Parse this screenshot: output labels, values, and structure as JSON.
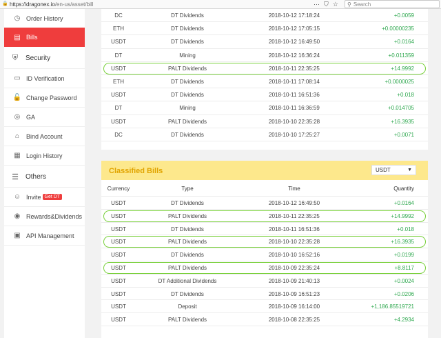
{
  "browser": {
    "url_host": "https://dragonex.io",
    "url_path": "/en-us/asset/bill",
    "search_placeholder": "Search"
  },
  "sidebar": {
    "items": [
      {
        "label": "Order History",
        "icon": "history-icon"
      },
      {
        "label": "Bills",
        "icon": "bill-icon",
        "active": true
      }
    ],
    "security_title": "Security",
    "security_items": [
      {
        "label": "ID Verification",
        "icon": "id-card-icon"
      },
      {
        "label": "Change Password",
        "icon": "lock-icon"
      },
      {
        "label": "GA",
        "icon": "google-auth-icon"
      },
      {
        "label": "Bind Account",
        "icon": "link-icon"
      },
      {
        "label": "Login History",
        "icon": "calendar-icon"
      }
    ],
    "others_title": "Others",
    "others_items": [
      {
        "label": "Invite",
        "badge": "Get DT",
        "icon": "user-icon"
      },
      {
        "label": "Rewards&Dividends",
        "icon": "reward-icon"
      },
      {
        "label": "API Management",
        "icon": "api-icon"
      }
    ]
  },
  "bills": {
    "rows": [
      {
        "currency": "DC",
        "type": "DT Dividends",
        "time": "2018-10-12 17:18:24",
        "quantity": "+0.0059"
      },
      {
        "currency": "ETH",
        "type": "DT Dividends",
        "time": "2018-10-12 17:05:15",
        "quantity": "+0.00000235"
      },
      {
        "currency": "USDT",
        "type": "DT Dividends",
        "time": "2018-10-12 16:49:50",
        "quantity": "+0.0164"
      },
      {
        "currency": "DT",
        "type": "Mining",
        "time": "2018-10-12 16:36:24",
        "quantity": "+0.011359"
      },
      {
        "currency": "USDT",
        "type": "PALT Dividends",
        "time": "2018-10-11 22:35:25",
        "quantity": "+14.9992"
      },
      {
        "currency": "ETH",
        "type": "DT Dividends",
        "time": "2018-10-11 17:08:14",
        "quantity": "+0.0000025"
      },
      {
        "currency": "USDT",
        "type": "DT Dividends",
        "time": "2018-10-11 16:51:36",
        "quantity": "+0.018"
      },
      {
        "currency": "DT",
        "type": "Mining",
        "time": "2018-10-11 16:36:59",
        "quantity": "+0.014705"
      },
      {
        "currency": "USDT",
        "type": "PALT Dividends",
        "time": "2018-10-10 22:35:28",
        "quantity": "+16.3935"
      },
      {
        "currency": "DC",
        "type": "DT Dividends",
        "time": "2018-10-10 17:25:27",
        "quantity": "+0.0071"
      }
    ]
  },
  "classified": {
    "title": "Classified Bills",
    "selected_currency": "USDT",
    "headers": {
      "currency": "Currency",
      "type": "Type",
      "time": "Time",
      "quantity": "Quantity"
    },
    "rows": [
      {
        "currency": "USDT",
        "type": "DT Dividends",
        "time": "2018-10-12 16:49:50",
        "quantity": "+0.0164"
      },
      {
        "currency": "USDT",
        "type": "PALT Dividends",
        "time": "2018-10-11 22:35:25",
        "quantity": "+14.9992"
      },
      {
        "currency": "USDT",
        "type": "DT Dividends",
        "time": "2018-10-11 16:51:36",
        "quantity": "+0.018"
      },
      {
        "currency": "USDT",
        "type": "PALT Dividends",
        "time": "2018-10-10 22:35:28",
        "quantity": "+16.3935"
      },
      {
        "currency": "USDT",
        "type": "DT Dividends",
        "time": "2018-10-10 16:52:16",
        "quantity": "+0.0199"
      },
      {
        "currency": "USDT",
        "type": "PALT Dividends",
        "time": "2018-10-09 22:35:24",
        "quantity": "+8.8117"
      },
      {
        "currency": "USDT",
        "type": "DT Additional Dividends",
        "time": "2018-10-09 21:40:13",
        "quantity": "+0.0024"
      },
      {
        "currency": "USDT",
        "type": "DT Dividends",
        "time": "2018-10-09 16:51:23",
        "quantity": "+0.0206"
      },
      {
        "currency": "USDT",
        "type": "Deposit",
        "time": "2018-10-09 16:14:00",
        "quantity": "+1,186.85519721"
      },
      {
        "currency": "USDT",
        "type": "PALT Dividends",
        "time": "2018-10-08 22:35:25",
        "quantity": "+4.2934"
      }
    ]
  },
  "colors": {
    "accent": "#ef3d3d",
    "positive": "#2fa84f",
    "highlight": "#7bd13e",
    "classified_bg": "#fde88c"
  }
}
